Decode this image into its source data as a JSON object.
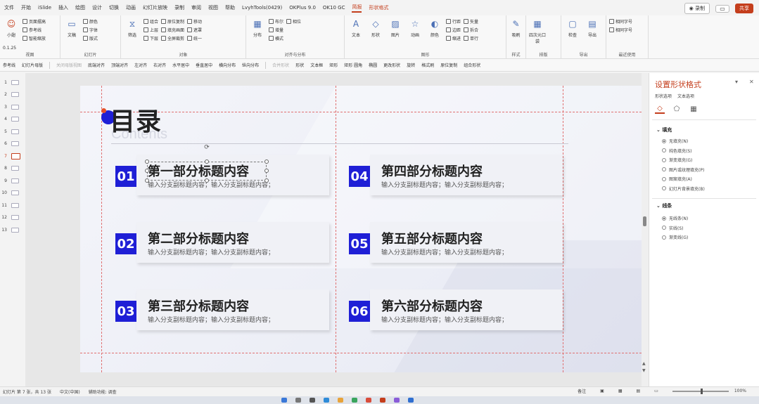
{
  "menu": {
    "items": [
      "文件",
      "开始",
      "iSlide",
      "插入",
      "绘图",
      "设计",
      "切换",
      "动画",
      "幻灯片放映",
      "录制",
      "审阅",
      "视图",
      "帮助",
      "LvyhTools(0429)",
      "OKPlus 9.0",
      "OK10 GC",
      "简报",
      "形状格式"
    ],
    "active": "简报",
    "record_label": "◉ 录制",
    "comment_icon": "comment-icon",
    "share_label": "共享"
  },
  "ribbon": {
    "groups": [
      {
        "label": "视图",
        "big": [
          {
            "label": "小翅",
            "icon": "cat-icon"
          }
        ],
        "small": [
          "页面摆高",
          "参考线",
          "智能缩放"
        ],
        "extra": "0.1.25"
      },
      {
        "label": "幻灯片",
        "big": [
          {
            "label": "文稿",
            "icon": "slides-icon"
          }
        ],
        "small": [
          "颜色",
          "字体",
          "版式"
        ]
      },
      {
        "label": "对象",
        "big": [
          {
            "label": "筛选",
            "icon": "filter-icon"
          }
        ],
        "small": [
          "组合",
          "上层",
          "下层",
          "原位复制",
          "填充画面",
          "全屏裁剪",
          "移动",
          "遮罩",
          "统一"
        ]
      },
      {
        "label": "对齐与分布",
        "big": [
          {
            "label": "分布",
            "icon": "distribute-icon"
          }
        ],
        "small": [
          "布尔",
          "增量",
          "横式",
          "相位"
        ]
      },
      {
        "label": "图形",
        "big": [
          {
            "label": "文本",
            "icon": "text-icon"
          },
          {
            "label": "形状",
            "icon": "shape-icon"
          },
          {
            "label": "图片",
            "icon": "picture-icon"
          },
          {
            "label": "动画",
            "icon": "animation-icon"
          },
          {
            "label": "颜色",
            "icon": "color-icon"
          }
        ],
        "small": [
          "行距",
          "边距",
          "缩进",
          "矢量",
          "拆合",
          "单行"
        ]
      },
      {
        "label": "样式",
        "big": [
          {
            "label": "吸刷",
            "icon": "brush-icon"
          }
        ],
        "small": []
      },
      {
        "label": "排版",
        "big": [
          {
            "label": "四次元口袋",
            "icon": "grid-icon"
          }
        ],
        "small": []
      },
      {
        "label": "导出",
        "big": [
          {
            "label": "检查",
            "icon": "inspect-icon"
          },
          {
            "label": "导出",
            "icon": "export-icon"
          }
        ],
        "small": []
      },
      {
        "label": "最近使用",
        "big": [],
        "small": [
          "相同字号",
          "相同字号"
        ]
      }
    ]
  },
  "quickbar": {
    "items": [
      "参考线",
      "幻灯片母版",
      "关闭母版视图",
      "底端对齐",
      "顶端对齐",
      "左对齐",
      "右对齐",
      "水平居中",
      "垂直居中",
      "横向分布",
      "纵向分布",
      "合并形状",
      "形状",
      "文本框",
      "矩形",
      "矩形 圆角",
      "椭圆",
      "更改形状",
      "旋转",
      "格式刷",
      "原位复制",
      "组合形状"
    ],
    "dim": [
      "关闭母版视图",
      "合并形状"
    ]
  },
  "thumbnails": {
    "numbers": [
      "1",
      "2",
      "3",
      "4",
      "5",
      "6",
      "7",
      "8",
      "9",
      "10",
      "11",
      "12",
      "13"
    ],
    "active": "7"
  },
  "slide": {
    "title": "目录",
    "subtitle": "Contents",
    "cards": [
      {
        "num": "01",
        "title": "第一部分标题内容",
        "sub": "输入分支副标题内容；输入分支副标题内容；"
      },
      {
        "num": "02",
        "title": "第二部分标题内容",
        "sub": "输入分支副标题内容；输入分支副标题内容；"
      },
      {
        "num": "03",
        "title": "第三部分标题内容",
        "sub": "输入分支副标题内容；输入分支副标题内容；"
      },
      {
        "num": "04",
        "title": "第四部分标题内容",
        "sub": "输入分支副标题内容；输入分支副标题内容；"
      },
      {
        "num": "05",
        "title": "第五部分标题内容",
        "sub": "输入分支副标题内容；输入分支副标题内容；"
      },
      {
        "num": "06",
        "title": "第六部分标题内容",
        "sub": "输入分支副标题内容；输入分支副标题内容；"
      }
    ],
    "accent_color": "#1f1fd6",
    "dot_color": "#e5502a"
  },
  "pane": {
    "title": "设置形状格式",
    "tabs": [
      "形状选项",
      "文本选项"
    ],
    "icons": [
      "fill-line-icon",
      "effects-icon",
      "size-properties-icon"
    ],
    "fill": {
      "heading": "填充",
      "options": [
        "无填充(N)",
        "纯色填充(S)",
        "渐变填充(G)",
        "图片或纹理填充(P)",
        "图案填充(A)",
        "幻灯片背景填充(B)"
      ],
      "selected": "无填充(N)"
    },
    "line": {
      "heading": "线条",
      "options": [
        "无线条(N)",
        "实线(S)",
        "渐变线(G)"
      ],
      "selected": "无线条(N)"
    }
  },
  "status": {
    "slide_info": "幻灯片 第 7 张，共 13 张",
    "language": "中文(中国)",
    "accessibility": "辅助功能: 调查",
    "notes": "备注",
    "zoom": "100%"
  },
  "accent": "#c43e1c"
}
